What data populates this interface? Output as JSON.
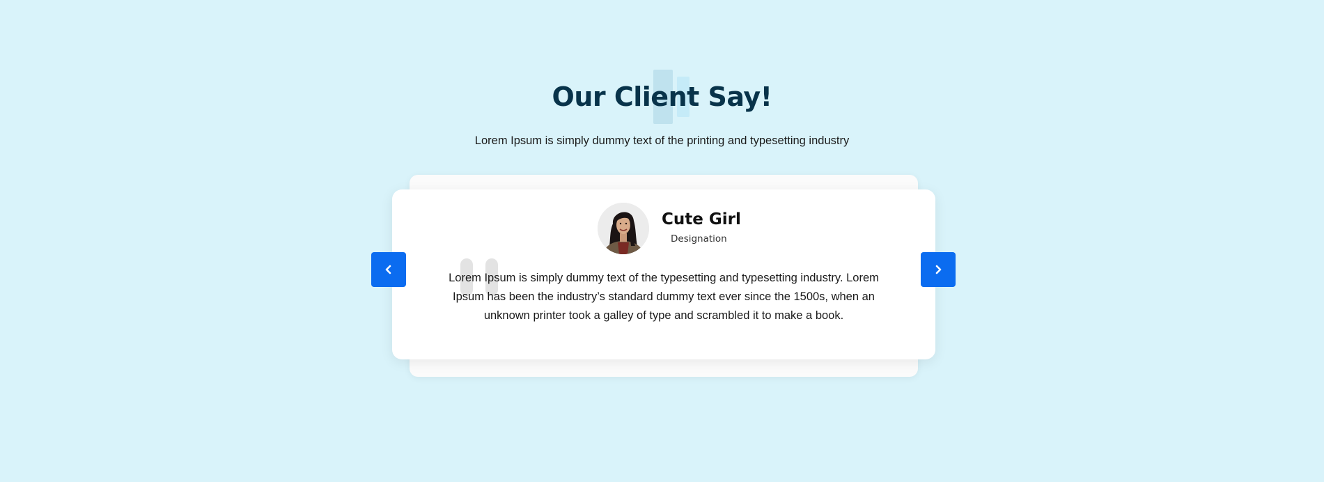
{
  "section": {
    "title": "Our Client Say!",
    "subtitle": "Lorem Ipsum is simply dummy text of the printing and typesetting industry"
  },
  "testimonial": {
    "author_name": "Cute Girl",
    "author_role": "Designation",
    "avatar_icon": "woman-portrait-avatar",
    "quote_icon": "quote-mark-icon",
    "text": "Lorem Ipsum is simply dummy text of the typesetting and typesetting industry. Lorem Ipsum has been the industry’s standard dummy text ever since the 1500s, when an unknown printer took a galley of type and scrambled it to make a book."
  },
  "carousel": {
    "prev_icon": "chevron-left-icon",
    "next_icon": "chevron-right-icon"
  },
  "colors": {
    "background": "#d9f3fa",
    "title": "#08334a",
    "accent_button": "#0b6cf0",
    "card": "#ffffff"
  }
}
